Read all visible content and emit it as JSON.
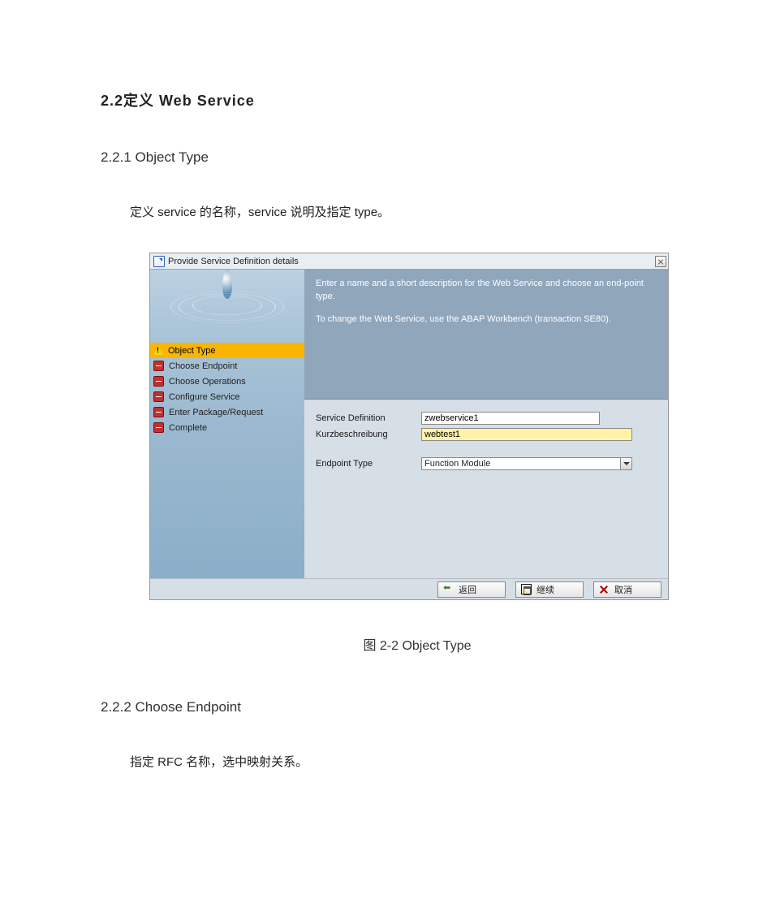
{
  "doc": {
    "section_title": "2.2定义 Web Service",
    "sub1_title": "2.2.1  Object Type",
    "sub1_para": "定义 service 的名称，service 说明及指定 type。",
    "fig_caption": "图 2‑2 Object Type",
    "sub2_title": "2.2.2  Choose Endpoint",
    "sub2_para": "指定 RFC 名称，选中映射关系。"
  },
  "dialog": {
    "title": "Provide Service Definition details",
    "steps": [
      {
        "label": "Object Type",
        "icon": "warn",
        "selected": true
      },
      {
        "label": "Choose Endpoint",
        "icon": "stop",
        "selected": false
      },
      {
        "label": "Choose Operations",
        "icon": "stop",
        "selected": false
      },
      {
        "label": "Configure Service",
        "icon": "stop",
        "selected": false
      },
      {
        "label": "Enter Package/Request",
        "icon": "stop",
        "selected": false
      },
      {
        "label": "Complete",
        "icon": "stop",
        "selected": false
      }
    ],
    "instructions": {
      "line1": "Enter a name and a short description for the Web Service and choose an end-point type.",
      "line2": "To change the Web Service, use the ABAP Workbench (transaction SE80)."
    },
    "form": {
      "service_def_label": "Service Definition",
      "service_def_value": "zwebservice1",
      "kurz_label": "Kurzbeschreibung",
      "kurz_value": "webtest1",
      "endpoint_label": "Endpoint Type",
      "endpoint_value": "Function Module"
    },
    "buttons": {
      "back": "返回",
      "continue": "继续",
      "cancel": "取消"
    }
  }
}
